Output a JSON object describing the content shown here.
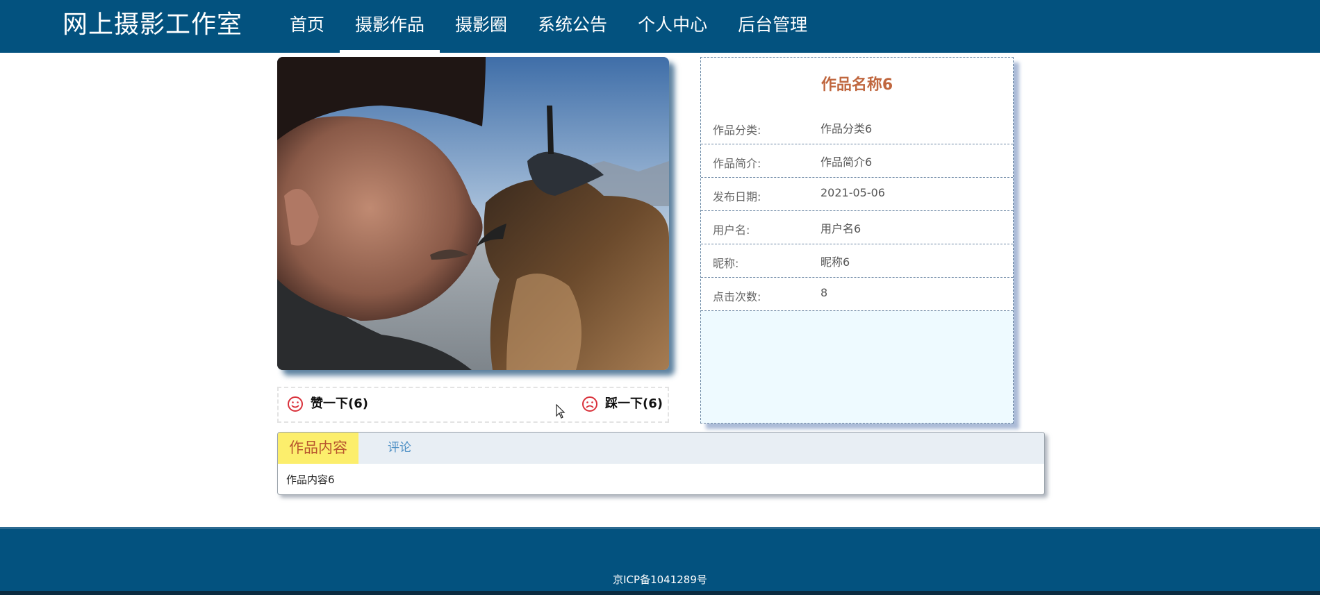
{
  "header": {
    "logo": "网上摄影工作室",
    "nav": [
      {
        "label": "首页",
        "active": false
      },
      {
        "label": "摄影作品",
        "active": true
      },
      {
        "label": "摄影圈",
        "active": false
      },
      {
        "label": "系统公告",
        "active": false
      },
      {
        "label": "个人中心",
        "active": false
      },
      {
        "label": "后台管理",
        "active": false
      }
    ]
  },
  "vote": {
    "like_label": "赞一下(6)",
    "dislike_label": "踩一下(6)"
  },
  "info": {
    "title": "作品名称6",
    "rows": [
      {
        "key": "作品分类:",
        "value": "作品分类6"
      },
      {
        "key": "作品简介:",
        "value": "作品简介6"
      },
      {
        "key": "发布日期:",
        "value": "2021-05-06"
      },
      {
        "key": "用户名:",
        "value": "用户名6"
      },
      {
        "key": "昵称:",
        "value": "昵称6"
      },
      {
        "key": "点击次数:",
        "value": "8"
      }
    ]
  },
  "tabs": {
    "items": [
      {
        "label": "作品内容",
        "active": true
      },
      {
        "label": "评论",
        "active": false
      }
    ],
    "content": "作品内容6"
  },
  "footer": {
    "icp": "京ICP备1041289号"
  },
  "colors": {
    "header_bg": "#03527f",
    "title_color": "#c0673f",
    "active_tab_bg": "#fcee6c",
    "vote_icon": "#d9303a"
  }
}
